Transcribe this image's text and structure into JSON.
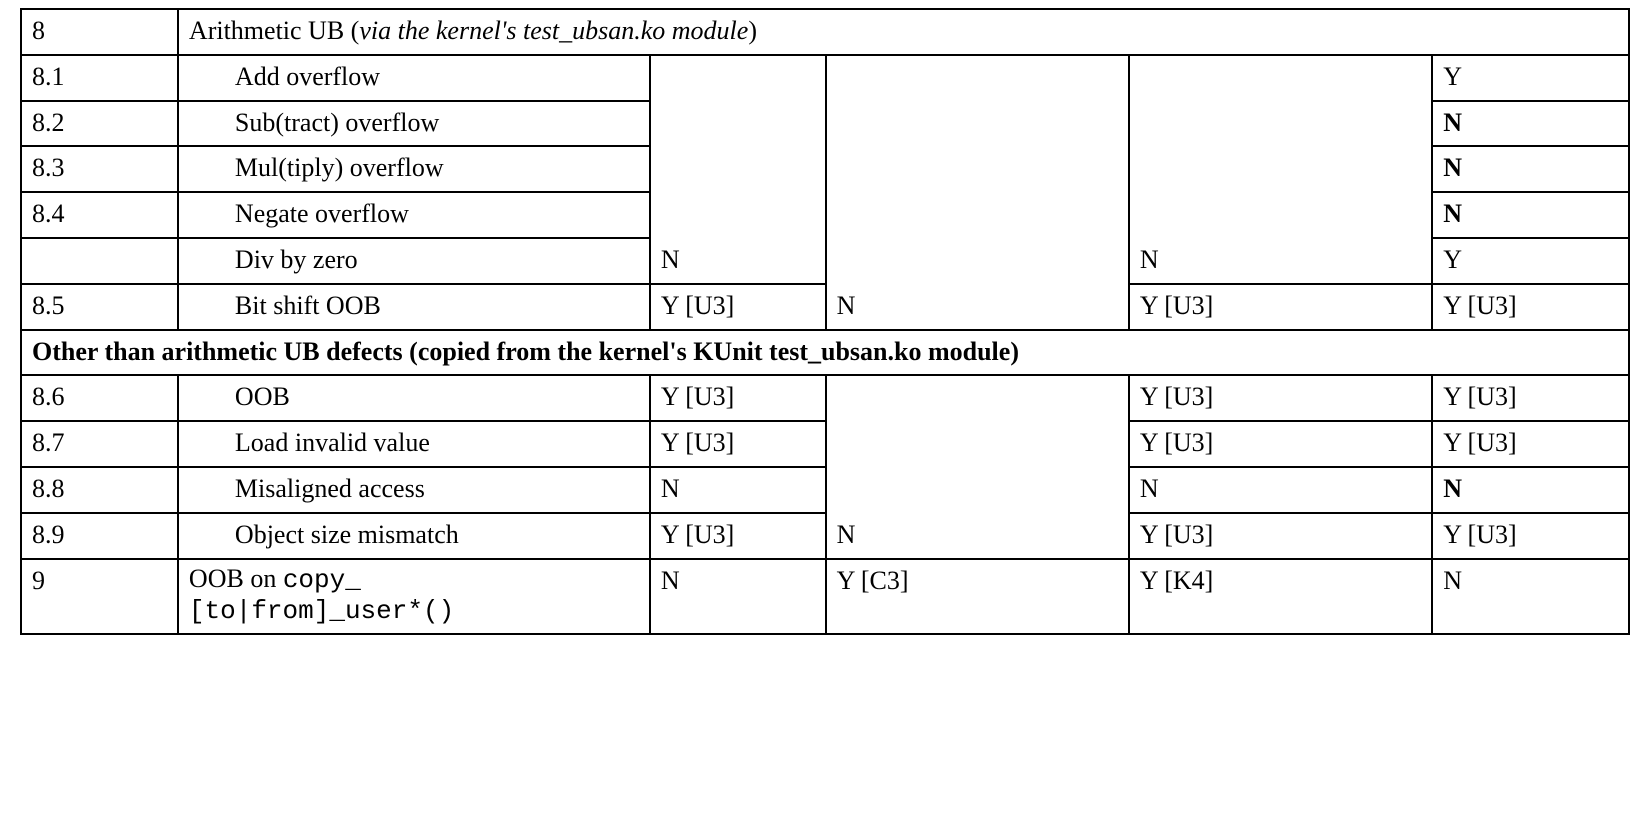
{
  "r8": {
    "num": "8",
    "desc_pre": "Arithmetic UB (",
    "desc_ital": "via the kernel's test_ubsan.ko module",
    "desc_post": ")"
  },
  "r81": {
    "num": "8.1",
    "desc": "Add overflow",
    "c6": "Y"
  },
  "r82": {
    "num": "8.2",
    "desc": "Sub(tract) overflow",
    "c6": "N"
  },
  "r83": {
    "num": "8.3",
    "desc": "Mul(tiply) overflow",
    "c6": "N"
  },
  "r84": {
    "num": "8.4",
    "desc": "Negate overflow",
    "c6": "N"
  },
  "rdz": {
    "num": "",
    "desc": "Div by zero",
    "c6": "Y"
  },
  "merge1": {
    "c3": "N",
    "c4": "N",
    "c5": "N"
  },
  "r85": {
    "num": "8.5",
    "desc": "Bit shift OOB",
    "c3": "Y [U3]",
    "c5": "Y [U3]",
    "c6": "Y [U3]"
  },
  "hdr": {
    "text": "Other than arithmetic UB defects (copied from the kernel's KUnit test_ubsan.ko module)"
  },
  "r86": {
    "num": "8.6",
    "desc": "OOB",
    "c3": "Y [U3]",
    "c5": "Y [U3]",
    "c6": "Y [U3]"
  },
  "r87": {
    "num": "8.7",
    "desc": "Load invalid value",
    "c3": "Y [U3]",
    "c5": "Y [U3]",
    "c6": "Y [U3]"
  },
  "r88": {
    "num": "8.8",
    "desc": "Misaligned access",
    "c3": "N",
    "c5": "N",
    "c6": "N"
  },
  "r89": {
    "num": "8.9",
    "desc": "Object size mismatch",
    "c3": "Y [U3]",
    "c5": "Y [U3]",
    "c6": "Y [U3]"
  },
  "merge2": {
    "c4": "N"
  },
  "r9": {
    "num": "9",
    "desc_pre": "OOB on ",
    "desc_mono1": "copy_",
    "br": "",
    "desc_mono2": "[to|from]_user*()",
    "c3": "N",
    "c4": "Y [C3]",
    "c5": "Y [K4]",
    "c6": "N"
  }
}
